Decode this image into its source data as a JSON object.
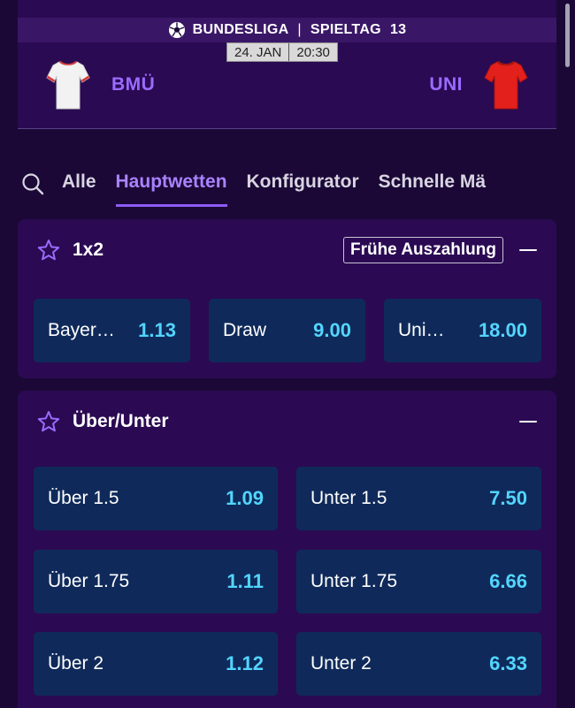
{
  "header": {
    "league": "BUNDESLIGA",
    "separator": "|",
    "matchday_label": "SPIELTAG",
    "matchday_number": "13",
    "date": "24. JAN",
    "time": "20:30",
    "home_team": {
      "short": "BMÜ",
      "shirt_color": "#f2f2f2",
      "accent": "#d83a3a"
    },
    "away_team": {
      "short": "UNI",
      "shirt_color": "#e3201b"
    }
  },
  "tabs": [
    {
      "label": "Alle",
      "active": false
    },
    {
      "label": "Hauptwetten",
      "active": true
    },
    {
      "label": "Konfigurator",
      "active": false
    },
    {
      "label": "Schnelle Mä",
      "active": false
    }
  ],
  "markets": {
    "one_x_two": {
      "title": "1x2",
      "badge": "Frühe Auszahlung",
      "odds": [
        {
          "label": "Bayer…",
          "value": "1.13"
        },
        {
          "label": "Draw",
          "value": "9.00"
        },
        {
          "label": "Uni…",
          "value": "18.00"
        }
      ]
    },
    "over_under": {
      "title": "Über/Unter",
      "odds": [
        {
          "label": "Über 1.5",
          "value": "1.09"
        },
        {
          "label": "Unter 1.5",
          "value": "7.50"
        },
        {
          "label": "Über 1.75",
          "value": "1.11"
        },
        {
          "label": "Unter 1.75",
          "value": "6.66"
        },
        {
          "label": "Über 2",
          "value": "1.12"
        },
        {
          "label": "Unter 2",
          "value": "6.33"
        }
      ]
    }
  },
  "colors": {
    "background": "#1b0836",
    "card": "#2b0a53",
    "odd_button": "#0f2a5a",
    "odd_value": "#53d5ff",
    "accent": "#8c5cf6",
    "team_name": "#9b6bff"
  }
}
